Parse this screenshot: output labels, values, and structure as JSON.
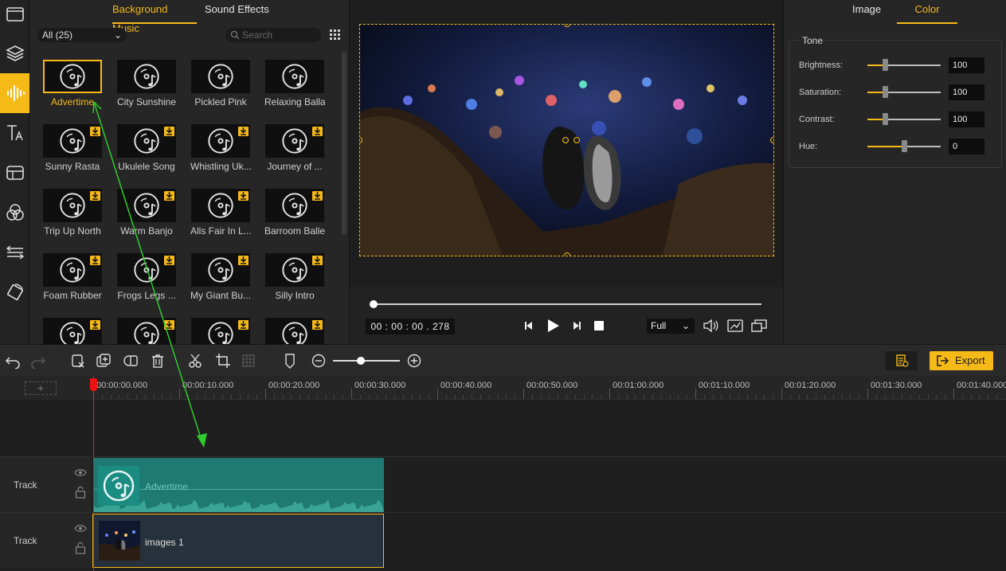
{
  "library": {
    "tabs": [
      "Background Music",
      "Sound Effects"
    ],
    "filter_value": "All (25)",
    "search_placeholder": "Search",
    "tracks": [
      {
        "name": "Advertime",
        "downloadable": false,
        "selected": true
      },
      {
        "name": "City Sunshine",
        "downloadable": false
      },
      {
        "name": "Pickled Pink",
        "downloadable": false
      },
      {
        "name": "Relaxing Ballad",
        "downloadable": false
      },
      {
        "name": "Sunny Rasta",
        "downloadable": true
      },
      {
        "name": "Ukulele Song",
        "downloadable": true
      },
      {
        "name": "Whistling Uk...",
        "downloadable": true
      },
      {
        "name": "Journey of ...",
        "downloadable": true
      },
      {
        "name": "Trip Up North",
        "downloadable": true
      },
      {
        "name": "Warm Banjo",
        "downloadable": true
      },
      {
        "name": "Alls Fair In L...",
        "downloadable": true
      },
      {
        "name": "Barroom Ballet",
        "downloadable": true
      },
      {
        "name": "Foam Rubber",
        "downloadable": true
      },
      {
        "name": "Frogs Legs ...",
        "downloadable": true
      },
      {
        "name": "My Giant Bu...",
        "downloadable": true
      },
      {
        "name": "Silly Intro",
        "downloadable": true
      },
      {
        "name": "",
        "downloadable": true
      },
      {
        "name": "",
        "downloadable": true
      },
      {
        "name": "",
        "downloadable": true
      },
      {
        "name": "",
        "downloadable": true
      }
    ]
  },
  "preview": {
    "timecode": "00 : 00 : 00 . 278",
    "quality": "Full",
    "progress": 0.0
  },
  "properties": {
    "tabs": [
      "Image",
      "Color"
    ],
    "active_tab": "Color",
    "group_label": "Tone",
    "sliders": [
      {
        "label": "Brightness:",
        "value": "100",
        "level": 0.24
      },
      {
        "label": "Saturation:",
        "value": "100",
        "level": 0.24
      },
      {
        "label": "Contrast:",
        "value": "100",
        "level": 0.24
      },
      {
        "label": "Hue:",
        "value": "0",
        "level": 0.5
      }
    ]
  },
  "toolbar": {
    "export_label": "Export",
    "zoom_level": 0.42
  },
  "timeline": {
    "ticks": [
      "00:00:00.000",
      "00:00:10.000",
      "00:00:20.000",
      "00:00:30.000",
      "00:00:40.000",
      "00:00:50.000",
      "00:01:00.000",
      "00:01:10.000",
      "00:01:20.000",
      "00:01:30.000",
      "00:01:40.000"
    ],
    "tracks": [
      {
        "label": "Track",
        "clip": "Advertime"
      },
      {
        "label": "Track",
        "clip": "images 1"
      }
    ]
  },
  "colors": {
    "accent": "#f5b918",
    "audio_clip": "#1e7a72",
    "drag_arrow": "#2ecc2e"
  }
}
